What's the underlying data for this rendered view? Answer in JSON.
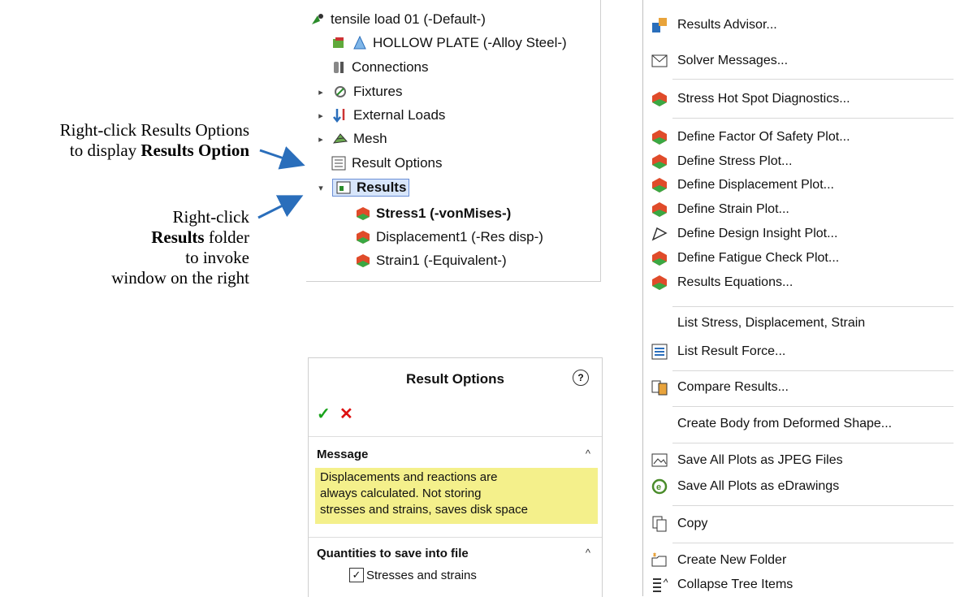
{
  "annotations": {
    "top_line1": "Right-click Results Options",
    "top_line2_prefix": "to display ",
    "top_line2_bold": "Results Option",
    "bottom_line1": "Right-click",
    "bottom_line2_bold": "Results",
    "bottom_line2_suffix": " folder",
    "bottom_line3": "to invoke",
    "bottom_line4": "window on the right"
  },
  "tree": {
    "items": [
      {
        "label": "tensile load 01 (-Default-)",
        "icon": "study-icon"
      },
      {
        "label": "HOLLOW PLATE (-Alloy Steel-)",
        "icon": "part-icon"
      },
      {
        "label": "Connections",
        "icon": "connections-icon"
      },
      {
        "label": "Fixtures",
        "icon": "fixtures-icon"
      },
      {
        "label": "External Loads",
        "icon": "external-loads-icon"
      },
      {
        "label": "Mesh",
        "icon": "mesh-icon"
      },
      {
        "label": "Result Options",
        "icon": "result-options-icon"
      },
      {
        "label": "Results",
        "icon": "results-folder-icon"
      },
      {
        "label": "Stress1 (-vonMises-)",
        "icon": "stress-plot-icon"
      },
      {
        "label": "Displacement1 (-Res disp-)",
        "icon": "displacement-plot-icon"
      },
      {
        "label": "Strain1 (-Equivalent-)",
        "icon": "strain-plot-icon"
      }
    ]
  },
  "result_options": {
    "title": "Result Options",
    "help": "?",
    "ok": "✓",
    "cancel": "✕",
    "message_header": "Message",
    "message_lines": [
      "Displacements and reactions are",
      " always calculated. Not storing",
      " stresses and strains, saves disk space"
    ],
    "quantities_header": "Quantities to save into file",
    "checkbox_label": "Stresses and strains",
    "collapse_glyph": "^"
  },
  "menu": {
    "items": [
      {
        "label": "Results Advisor...",
        "icon": "results-advisor-icon"
      },
      {
        "label": "Solver Messages...",
        "icon": "solver-messages-icon"
      },
      {
        "label": "Stress Hot Spot Diagnostics...",
        "icon": "hot-spot-icon"
      },
      {
        "label": "Define Factor Of Safety Plot...",
        "icon": "factor-of-safety-icon"
      },
      {
        "label": "Define Stress Plot...",
        "icon": "stress-plot-icon"
      },
      {
        "label": "Define Displacement Plot...",
        "icon": "displacement-plot-icon"
      },
      {
        "label": "Define Strain Plot...",
        "icon": "strain-plot-icon"
      },
      {
        "label": "Define Design Insight Plot...",
        "icon": "design-insight-icon"
      },
      {
        "label": "Define Fatigue Check Plot...",
        "icon": "fatigue-check-icon"
      },
      {
        "label": "Results Equations...",
        "icon": "results-equations-icon"
      },
      {
        "label": "List Stress, Displacement, Strain",
        "icon": ""
      },
      {
        "label": "List Result Force...",
        "icon": "list-result-force-icon"
      },
      {
        "label": "Compare Results...",
        "icon": "compare-results-icon"
      },
      {
        "label": "Create Body from Deformed Shape...",
        "icon": ""
      },
      {
        "label": "Save All Plots as JPEG Files",
        "icon": "save-jpeg-icon"
      },
      {
        "label": "Save All Plots as eDrawings",
        "icon": "edrawings-icon"
      },
      {
        "label": "Copy",
        "icon": "copy-icon"
      },
      {
        "label": "Create New Folder",
        "icon": "new-folder-icon"
      },
      {
        "label": "Collapse Tree Items",
        "icon": "collapse-tree-icon"
      }
    ]
  },
  "colors": {
    "arrow": "#2a6ebb",
    "message_bg": "#f4f08b",
    "ok": "#19a31b",
    "cancel": "#dd1111",
    "selection": "#d8e6fb"
  }
}
